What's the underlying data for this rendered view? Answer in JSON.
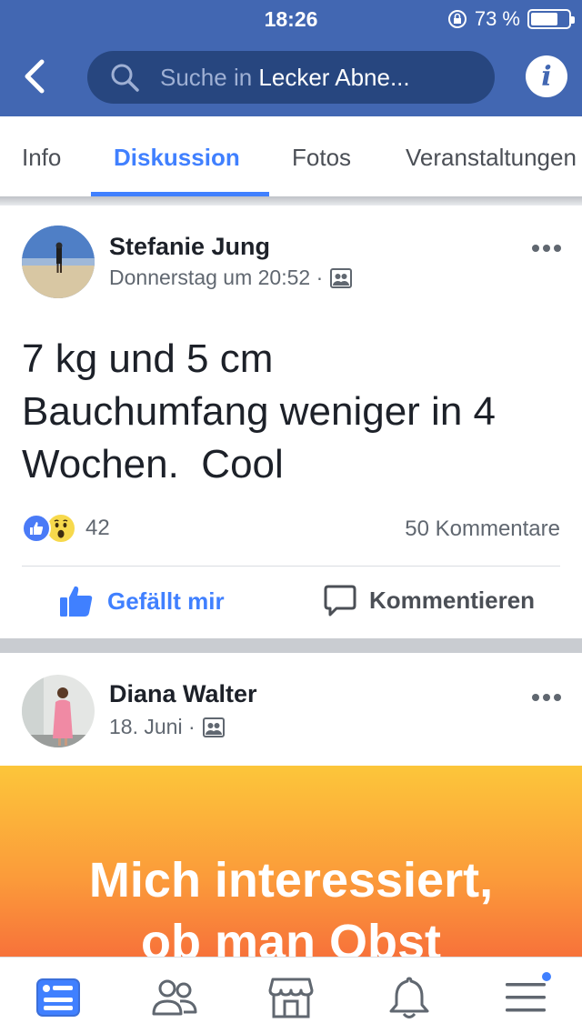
{
  "status_bar": {
    "time": "18:26",
    "battery_text": "73 %",
    "battery_level": 0.73
  },
  "header": {
    "search_placeholder": "Suche in ",
    "search_value": "Lecker Abne...",
    "info_label": "i"
  },
  "tabs": [
    {
      "label": "Info",
      "active": false
    },
    {
      "label": "Diskussion",
      "active": true
    },
    {
      "label": "Fotos",
      "active": false
    },
    {
      "label": "Veranstaltungen",
      "active": false
    }
  ],
  "posts": [
    {
      "author": "Stefanie Jung",
      "time": "Donnerstag um 20:52 ·",
      "text_lines": [
        "7 kg und 5 cm",
        "Bauchumfang weniger in 4",
        "Wochen.  Cool"
      ],
      "reaction_count": "42",
      "comments": "50 Kommentare",
      "like_label": "Gefällt mir",
      "comment_label": "Kommentieren"
    },
    {
      "author": "Diana Walter",
      "time": "18. Juni ·",
      "banner_lines": [
        "Mich interessiert,",
        "ob man Obst"
      ]
    }
  ],
  "colors": {
    "brand": "#4267b2",
    "search_bg": "#27467f",
    "accent": "#4080ff",
    "banner_top": "#fcc63a",
    "banner_bottom": "#f7723a"
  },
  "icons": [
    "back-icon",
    "search-icon",
    "info-icon",
    "group-icon",
    "more-icon",
    "like-icon",
    "wow-icon",
    "comment-icon",
    "news-feed-icon",
    "friends-icon",
    "marketplace-icon",
    "notifications-icon",
    "menu-icon"
  ]
}
